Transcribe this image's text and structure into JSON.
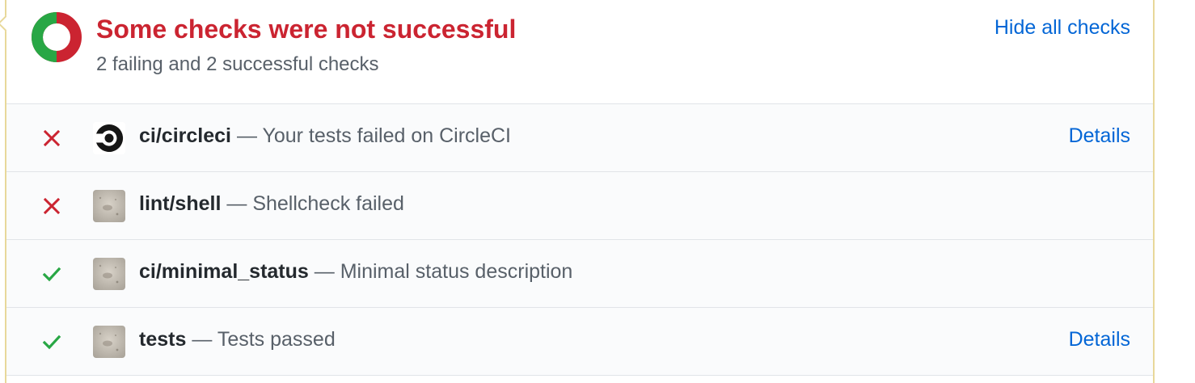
{
  "header": {
    "title": "Some checks were not successful",
    "summary": "2 failing and 2 successful checks",
    "toggle_label": "Hide all checks"
  },
  "colors": {
    "failure": "#cb2431",
    "success": "#28a745",
    "link": "#0366d6",
    "panel_border": "#e8d89a"
  },
  "checks": [
    {
      "name": "ci/circleci",
      "separator": "—",
      "description": "Your tests failed on CircleCI",
      "state": "failure",
      "status_icon": "x-icon",
      "avatar": "circleci-logo-icon",
      "details_label": "Details"
    },
    {
      "name": "lint/shell",
      "separator": "—",
      "description": "Shellcheck failed",
      "state": "failure",
      "status_icon": "x-icon",
      "avatar": "sand-avatar"
    },
    {
      "name": "ci/minimal_status",
      "separator": "—",
      "description": "Minimal status description",
      "state": "success",
      "status_icon": "check-icon",
      "avatar": "sand-avatar"
    },
    {
      "name": "tests",
      "separator": "—",
      "description": "Tests passed",
      "state": "success",
      "status_icon": "check-icon",
      "avatar": "sand-avatar",
      "details_label": "Details"
    }
  ]
}
